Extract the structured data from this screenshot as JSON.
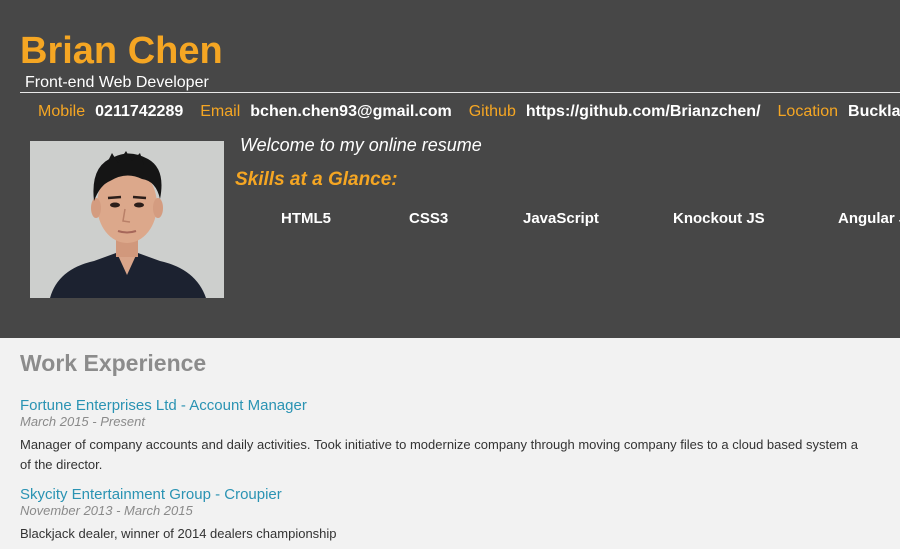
{
  "header": {
    "name": "Brian Chen",
    "subtitle": "Front-end Web Developer",
    "welcome": "Welcome to my online resume",
    "skills_title": "Skills at a Glance:"
  },
  "contacts": [
    {
      "label": "Mobile",
      "value": "0211742289"
    },
    {
      "label": "Email",
      "value": "bchen.chen93@gmail.com"
    },
    {
      "label": "Github",
      "value": "https://github.com/Brianzchen/"
    },
    {
      "label": "Location",
      "value": "Bucklands B"
    }
  ],
  "skills": [
    "HTML5",
    "CSS3",
    "JavaScript",
    "Knockout JS",
    "Angular J"
  ],
  "work": {
    "heading": "Work Experience",
    "jobs": [
      {
        "title": "Fortune Enterprises Ltd - Account Manager",
        "dates": "March 2015 - Present",
        "desc_line1": "Manager of company accounts and daily activities. Took initiative to modernize company through moving company files to a cloud based system a",
        "desc_line2": "of the director."
      },
      {
        "title": "Skycity Entertainment Group - Croupier",
        "dates": "November 2013 - March 2015",
        "desc_line1": "Blackjack dealer, winner of 2014 dealers championship"
      }
    ]
  },
  "colors": {
    "header_bg": "#474747",
    "accent": "#f5a623",
    "link": "#2a93b3",
    "page_bg": "#f2f2f2"
  },
  "icons": {
    "photo": "profile-photo"
  }
}
